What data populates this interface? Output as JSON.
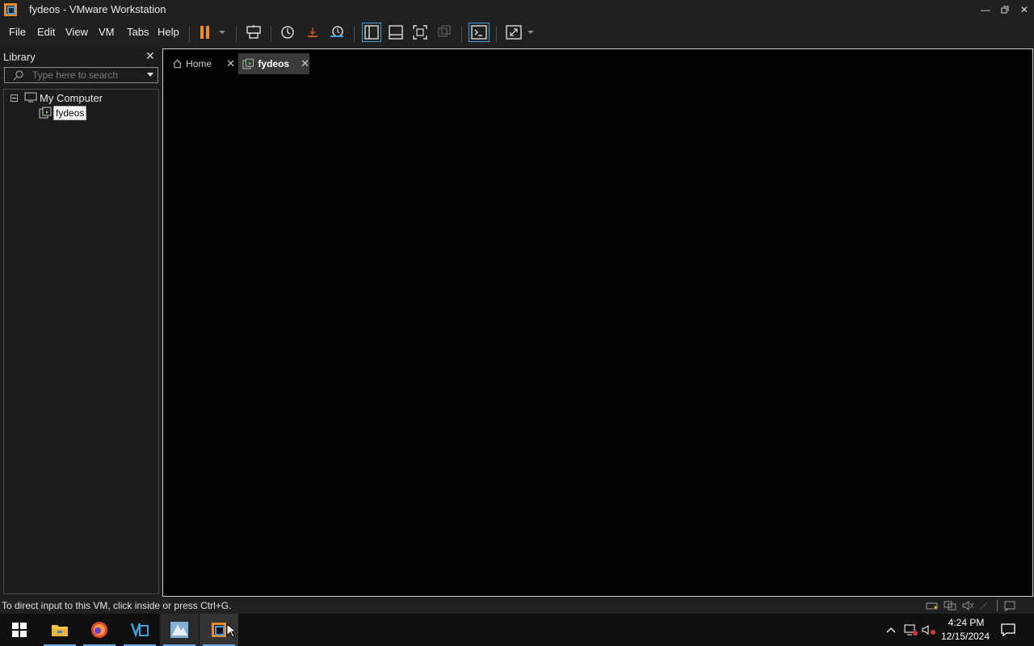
{
  "window": {
    "title": "fydeos - VMware Workstation"
  },
  "menu": {
    "file": "File",
    "edit": "Edit",
    "view": "View",
    "vm": "VM",
    "tabs": "Tabs",
    "help": "Help"
  },
  "library": {
    "title": "Library",
    "search_placeholder": "Type here to search",
    "tree": {
      "root": "My Computer",
      "child": "fydeos"
    }
  },
  "tabs": [
    {
      "label": "Home"
    },
    {
      "label": "fydeos"
    }
  ],
  "status": {
    "text": "To direct input to this VM, click inside or press Ctrl+G."
  },
  "clock": {
    "time": "4:24 PM",
    "date": "12/15/2024"
  },
  "colors": {
    "accent_orange": "#f08a24",
    "vm_blue": "#3fa0e0",
    "tab_active_bg": "#3a3a3a"
  }
}
